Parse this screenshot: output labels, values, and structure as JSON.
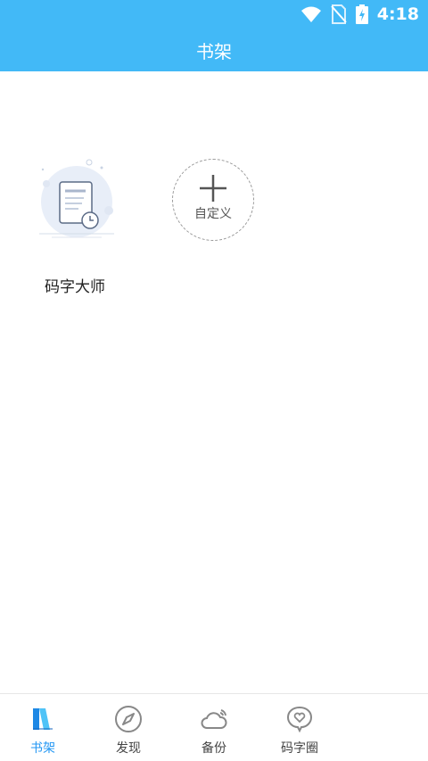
{
  "status_bar": {
    "time": "4:18"
  },
  "header": {
    "title": "书架"
  },
  "bookshelf": {
    "books": [
      {
        "title": "码字大师"
      }
    ],
    "add_custom_label": "自定义"
  },
  "bottom_nav": {
    "items": [
      {
        "label": "书架",
        "icon": "bookshelf-icon",
        "active": true
      },
      {
        "label": "发现",
        "icon": "compass-icon",
        "active": false
      },
      {
        "label": "备份",
        "icon": "cloud-icon",
        "active": false
      },
      {
        "label": "码字圈",
        "icon": "chat-heart-icon",
        "active": false
      }
    ]
  },
  "colors": {
    "accent": "#42b9f7",
    "active_label": "#2196f3"
  }
}
